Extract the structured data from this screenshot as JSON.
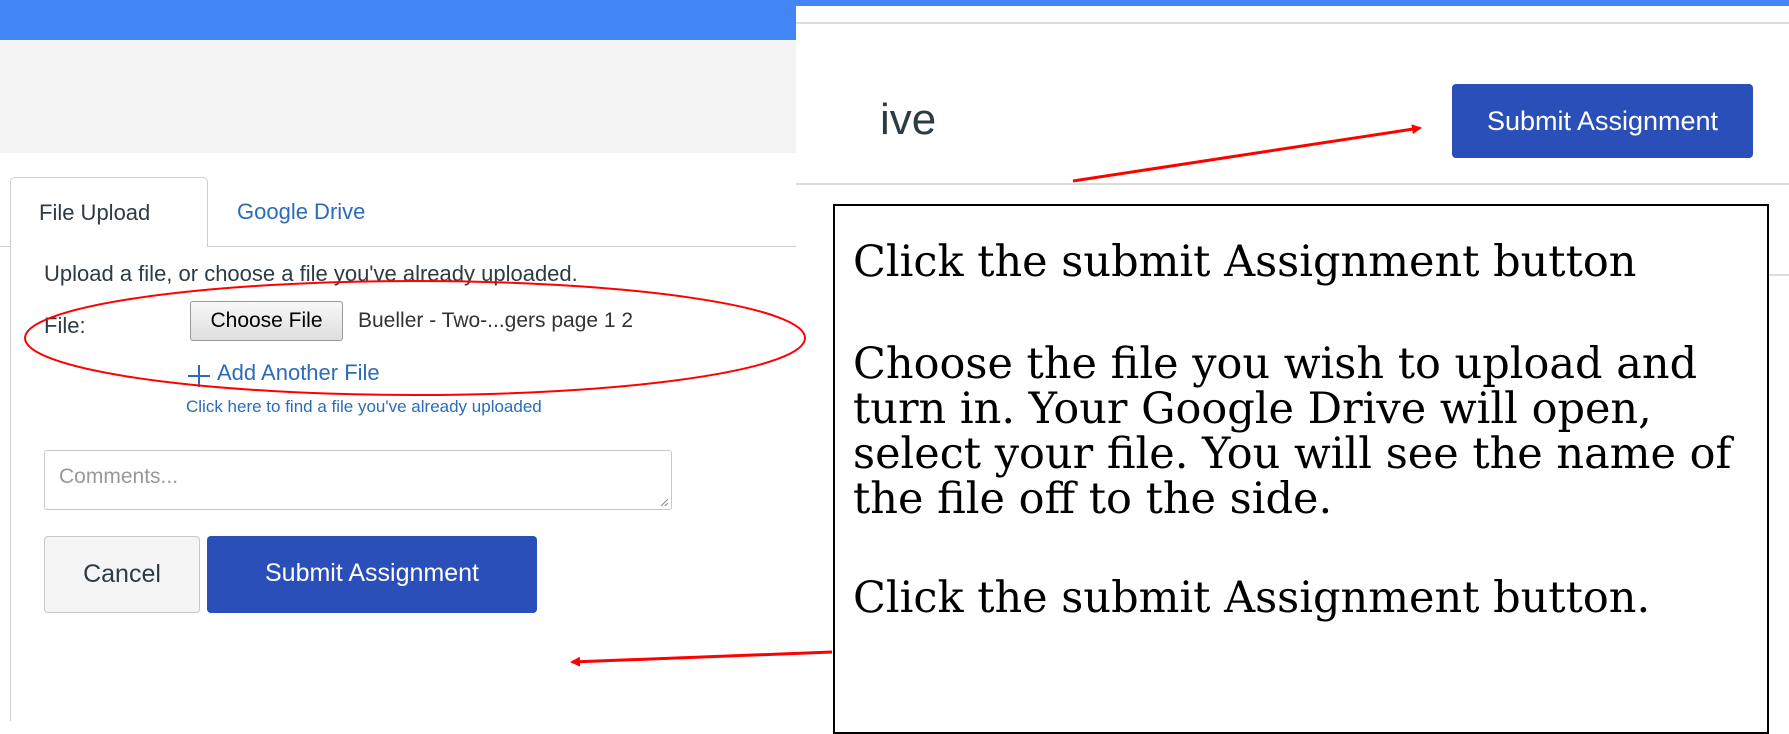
{
  "left_panel": {
    "tabs": [
      {
        "label": "File Upload"
      },
      {
        "label": "Google Drive"
      }
    ],
    "upload_instructions": "Upload a file, or choose a file you've already uploaded.",
    "file_label": "File:",
    "choose_file_label": "Choose File",
    "selected_file_name": "Bueller - Two-...gers page 1 2",
    "add_another_file": "Add Another File",
    "find_uploaded_link": "Click here to find a file you've already uploaded",
    "comments_placeholder": "Comments...",
    "cancel_label": "Cancel",
    "submit_label": "Submit Assignment"
  },
  "right_panel": {
    "title_fragment": "ive",
    "submit_label": "Submit Assignment"
  },
  "callout": {
    "line1": "Click the submit Assignment button",
    "para2": "Choose the file you wish to upload and turn in.  Your Google Drive will open, select your file.  You will see the name of the file off to the side.",
    "line3": "Click the submit Assignment button."
  },
  "colors": {
    "topbar": "#4285f4",
    "button_primary": "#2a4fb8",
    "link": "#2b6cb8",
    "annotation": "#ff0000"
  }
}
